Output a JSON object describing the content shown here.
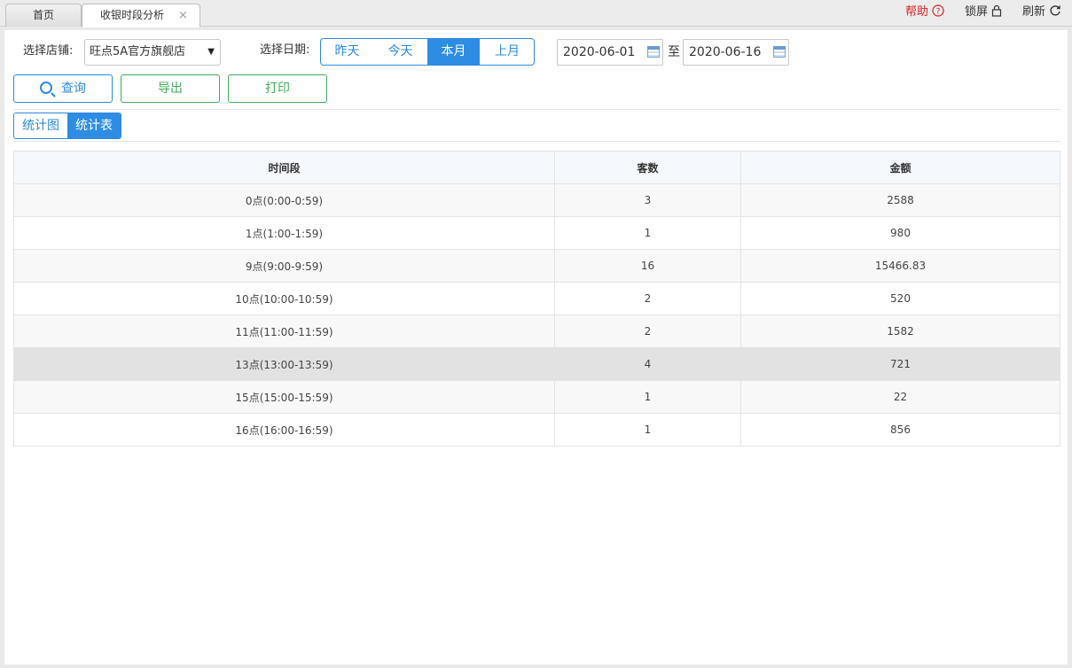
{
  "tabs": {
    "home": "首页",
    "active": "收银时段分析",
    "close": "×"
  },
  "topbar": {
    "help": "帮助",
    "lock": "锁屏",
    "refresh": "刷新"
  },
  "filters": {
    "store_label": "选择店铺:",
    "store_value": "旺点5A官方旗舰店",
    "date_label": "选择日期:",
    "quick_dates": [
      "昨天",
      "今天",
      "本月",
      "上月"
    ],
    "active_quick": "本月",
    "start_date": "2020-06-01",
    "to_label": "至",
    "end_date": "2020-06-16"
  },
  "actions": {
    "query": "查询",
    "export": "导出",
    "print": "打印"
  },
  "view_toggle": {
    "chart": "统计图",
    "table": "统计表",
    "active": "统计表"
  },
  "table": {
    "headers": [
      "时间段",
      "客数",
      "金额"
    ],
    "rows": [
      [
        "0点(0:00-0:59)",
        "3",
        "2588"
      ],
      [
        "1点(1:00-1:59)",
        "1",
        "980"
      ],
      [
        "9点(9:00-9:59)",
        "16",
        "15466.83"
      ],
      [
        "10点(10:00-10:59)",
        "2",
        "520"
      ],
      [
        "11点(11:00-11:59)",
        "2",
        "1582"
      ],
      [
        "13点(13:00-13:59)",
        "4",
        "721"
      ],
      [
        "15点(15:00-15:59)",
        "1",
        "22"
      ],
      [
        "16点(16:00-16:59)",
        "1",
        "856"
      ]
    ],
    "highlighted_row": 5
  },
  "colors": {
    "primary": "#2e8de3",
    "success": "#3fae5a",
    "help": "#e02020"
  }
}
